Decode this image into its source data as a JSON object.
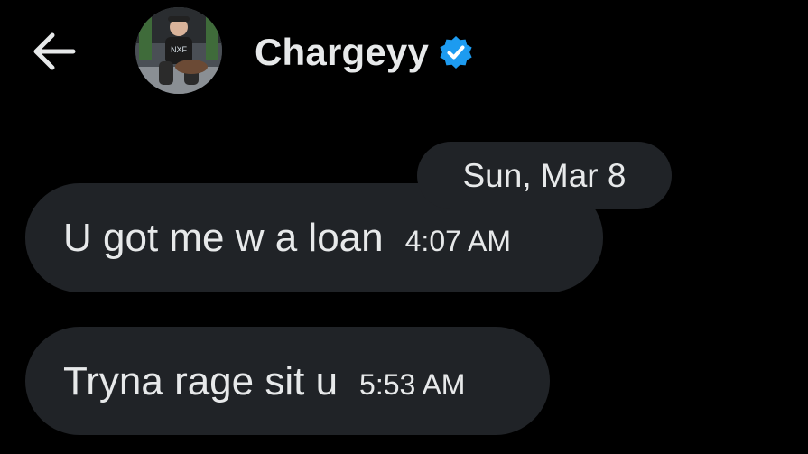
{
  "header": {
    "back_icon": "arrow-left-icon",
    "display_name": "Chargeyy",
    "verified_icon": "verified-badge-icon",
    "verified_color": "#1d9bf0"
  },
  "conversation": {
    "date_separator": "Sun, Mar 8",
    "messages": [
      {
        "text": "U got me w a loan",
        "time": "4:07 AM"
      },
      {
        "text": "Tryna rage sit u",
        "time": "5:53 AM"
      }
    ]
  },
  "colors": {
    "background": "#000000",
    "bubble": "#202327",
    "text": "#e7e9ea"
  }
}
